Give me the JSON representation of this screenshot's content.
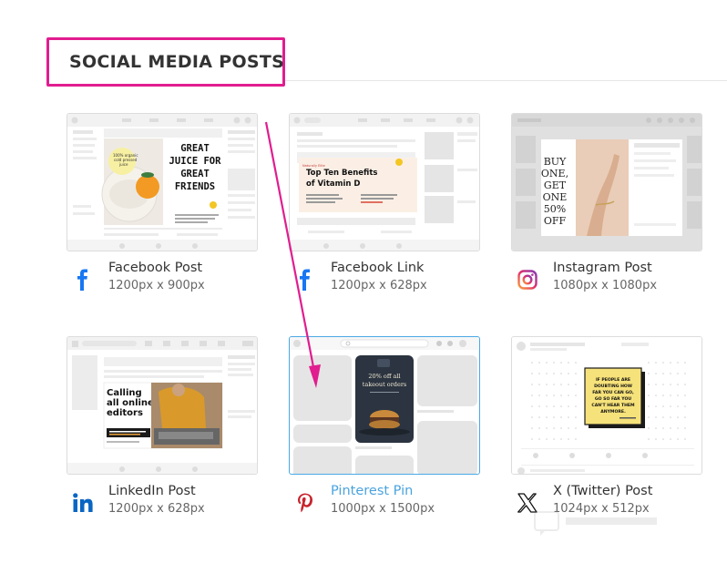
{
  "section": {
    "title": "SOCIAL MEDIA POSTS"
  },
  "colors": {
    "accent": "#e11d8f",
    "selected": "#4aa3df",
    "facebook": "#1877f2",
    "linkedin": "#0a66c2",
    "pinterest": "#e60023"
  },
  "cards": [
    {
      "label": "Facebook Post",
      "dims": "1200px x 900px",
      "icon": "facebook-icon",
      "preview": {
        "headline": "GREAT\nJUICE FOR\nGREAT\nFRIENDS",
        "badge": "100% organic\ncold pressed\njuice"
      }
    },
    {
      "label": "Facebook Link",
      "dims": "1200px x 628px",
      "icon": "facebook-icon",
      "preview": {
        "headline": "Top Ten Benefits\nof Vitamin D"
      }
    },
    {
      "label": "Instagram Post",
      "dims": "1080px x 1080px",
      "icon": "instagram-icon",
      "preview": {
        "headline": "BUY\nONE,\nGET\nONE\n50%\nOFF"
      }
    },
    {
      "label": "LinkedIn Post",
      "dims": "1200px x 628px",
      "icon": "linkedin-icon",
      "preview": {
        "headline": "Calling\nall online\neditors"
      }
    },
    {
      "label": "Pinterest Pin",
      "dims": "1000px x 1500px",
      "icon": "pinterest-icon",
      "preview": {
        "headline": "20% off all\ntakeout orders"
      }
    },
    {
      "label": "X (Twitter) Post",
      "dims": "1024px x 512px",
      "icon": "x-icon",
      "preview": {
        "headline": "IF PEOPLE ARE\nDOUBTING HOW\nFAR YOU CAN GO,\nGO SO FAR YOU\nCAN'T HEAR THEM\nANYMORE."
      }
    }
  ]
}
